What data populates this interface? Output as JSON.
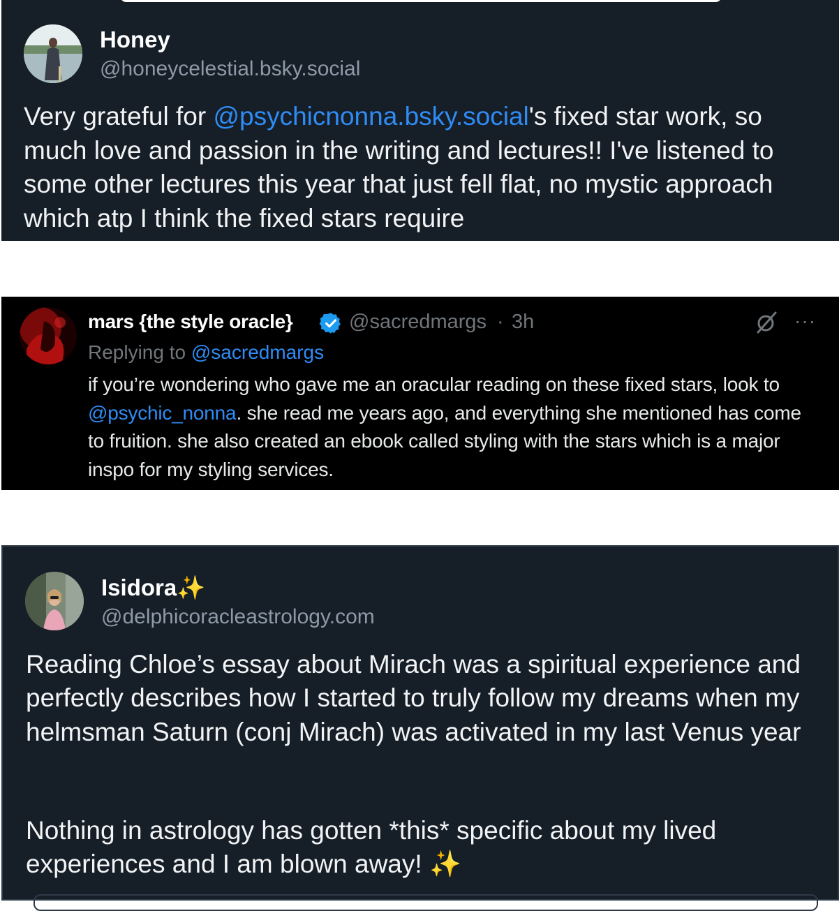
{
  "posts": [
    {
      "author_name": "Honey",
      "handle": "@honeycelestial.bsky.social",
      "body_prefix": "Very grateful for ",
      "mention": "@psychicnonna.bsky.social",
      "body_suffix": "'s fixed star work, so much love and passion in the writing and lectures!! I've listened to some other lectures this year that just fell flat, no mystic approach which atp I think the fixed stars require"
    },
    {
      "author_name": "mars {the style oracle}",
      "handle": "@sacredmargs",
      "separator": "·",
      "time": "3h",
      "more_label": "···",
      "replying_label": "Replying to ",
      "replying_to": "@sacredmargs",
      "body_prefix": "if you’re wondering who gave me an oracular reading on these fixed stars, look to ",
      "mention": "@psychic_nonna",
      "body_suffix": ". she read me years ago, and everything she mentioned has come to fruition. she also created an ebook called styling with the stars which is a major inspo for my styling services."
    },
    {
      "author_name": "Isidora",
      "name_emoji": "✨",
      "handle": "@delphicoracleastrology.com",
      "paragraph1": "Reading Chloe’s essay about Mirach was a spiritual experience and perfectly describes how I started to truly follow my dreams when my helmsman Saturn (conj Mirach) was activated in my last Venus year",
      "paragraph2": "Nothing in astrology has gotten *this* specific about my lived experiences and I am blown away! ",
      "paragraph2_emoji": "✨"
    }
  ],
  "colors": {
    "dark_card_bg": "#161e27",
    "black_card_bg": "#000000",
    "mention_blue": "#2f8cf5",
    "verified_blue": "#1d9bf0",
    "muted_text": "#8e9aa8"
  },
  "icons": {
    "verified": "verified-badge-icon",
    "grok": "grok-icon",
    "more": "more-options-icon"
  }
}
